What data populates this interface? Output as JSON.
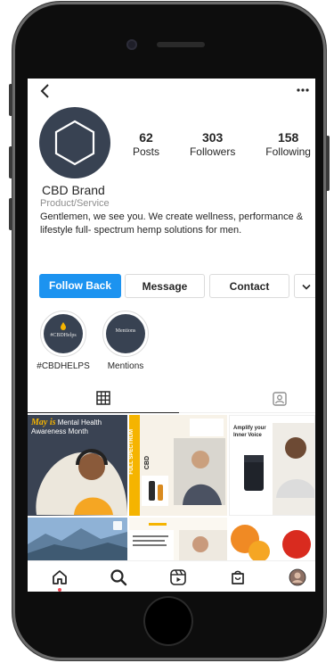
{
  "profile": {
    "name": "CBD Brand",
    "category": "Product/Service",
    "bio": "Gentlemen, we see you. We create wellness, performance & lifestyle full- spectrum hemp solutions for men."
  },
  "stats": [
    {
      "value": "62",
      "label": "Posts"
    },
    {
      "value": "303",
      "label": "Followers"
    },
    {
      "value": "158",
      "label": "Following"
    }
  ],
  "actions": {
    "follow_back": "Follow Back",
    "message": "Message",
    "contact": "Contact",
    "more": "⌄"
  },
  "highlights": [
    {
      "cover_text": "#CBDHelps",
      "label": "#CBDHELPS"
    },
    {
      "cover_text": "Mentions",
      "label": "Mentions"
    }
  ],
  "posts": {
    "p1_title_em": "May is",
    "p1_title": "Mental Health Awareness Month",
    "p2_side": "FULL SPECTRUM",
    "p2_tag": "CBD",
    "p3_title": "Amplify your Inner Voice"
  },
  "colors": {
    "accent_blue": "#1c93f0",
    "brand_slate": "#384252",
    "brand_gold": "#f5b400",
    "notification_red": "#ed4956"
  },
  "icons": {
    "back": "chevron-left-icon",
    "more": "three-dots-icon",
    "grid_tab": "grid-icon",
    "tagged_tab": "tagged-user-icon",
    "nav": [
      "home-icon",
      "search-icon",
      "reels-icon",
      "shop-icon",
      "profile-avatar"
    ]
  }
}
